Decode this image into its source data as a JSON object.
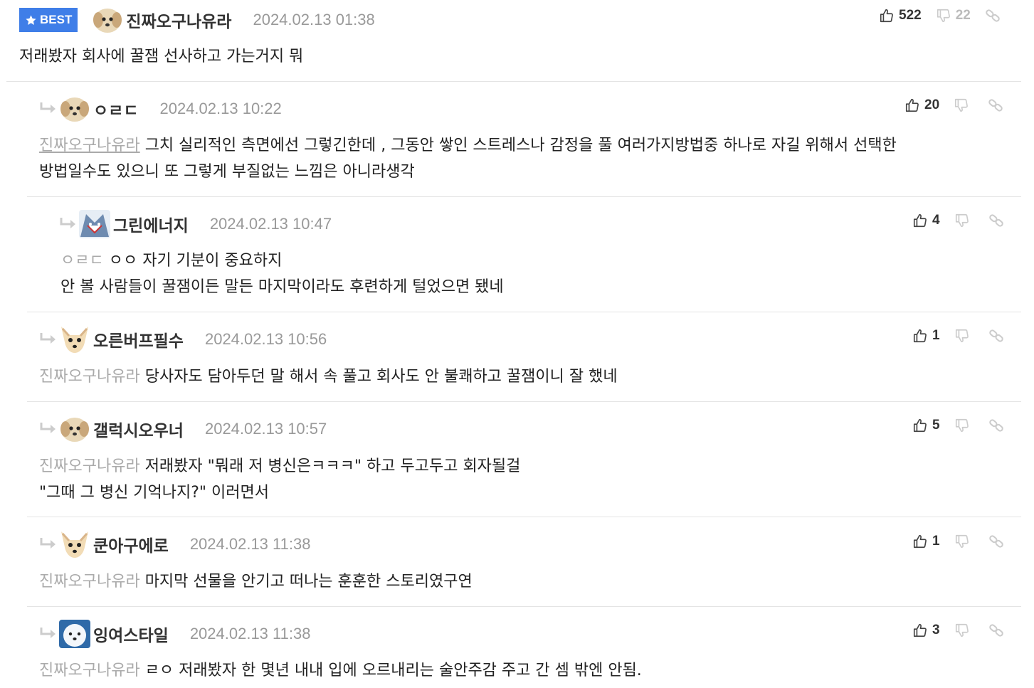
{
  "best_label": "BEST",
  "comments": [
    {
      "nick": "진짜오구나유라",
      "date": "2024.02.13 01:38",
      "up": "522",
      "down": "22",
      "mention": "",
      "lines": [
        "저래봤자 회사에 꿀잼 선사하고 가는거지 뭐"
      ]
    },
    {
      "nick": "ㅇㄹㄷ",
      "date": "2024.02.13 10:22",
      "up": "20",
      "down": "",
      "mention": "진짜오구나유라",
      "lines": [
        "그치 실리적인 측면에선 그렇긴한데 , 그동안 쌓인 스트레스나 감정을 풀 여러가지방법중 하나로 자길 위해서 선택한",
        "방법일수도 있으니 또 그렇게 부질없는 느낌은 아니라생각"
      ]
    },
    {
      "nick": "그린에너지",
      "date": "2024.02.13 10:47",
      "up": "4",
      "down": "",
      "mention": "ㅇㄹㄷ",
      "lines": [
        "ㅇㅇ 자기 기분이 중요하지",
        "안 볼 사람들이 꿀잼이든 말든 마지막이라도 후련하게 털었으면 됐네"
      ]
    },
    {
      "nick": "오른버프필수",
      "date": "2024.02.13 10:56",
      "up": "1",
      "down": "",
      "mention": "진짜오구나유라",
      "lines": [
        "당사자도 담아두던 말 해서 속 풀고 회사도 안 불쾌하고 꿀잼이니 잘 했네"
      ]
    },
    {
      "nick": "갤럭시오우너",
      "date": "2024.02.13 10:57",
      "up": "5",
      "down": "",
      "mention": "진짜오구나유라",
      "lines": [
        "저래봤자 \"뭐래 저 병신은ㅋㅋㅋ\" 하고 두고두고 회자될걸",
        "\"그때 그 병신 기억나지?\" 이러면서"
      ]
    },
    {
      "nick": "쿤아구에로",
      "date": "2024.02.13 11:38",
      "up": "1",
      "down": "",
      "mention": "진짜오구나유라",
      "lines": [
        "마지막 선물을 안기고 떠나는 훈훈한 스토리였구연"
      ]
    },
    {
      "nick": "잉여스타일",
      "date": "2024.02.13 11:38",
      "up": "3",
      "down": "",
      "mention": "진짜오구나유라",
      "lines": [
        "ㄹㅇ 저래봤자 한 몇년 내내 입에 오르내리는 술안주감 주고 간 셈 밖엔 안됨."
      ]
    }
  ],
  "colors": {
    "best_badge": "#3f7ee8",
    "mention": "#aaaaaa",
    "date": "#999999"
  }
}
